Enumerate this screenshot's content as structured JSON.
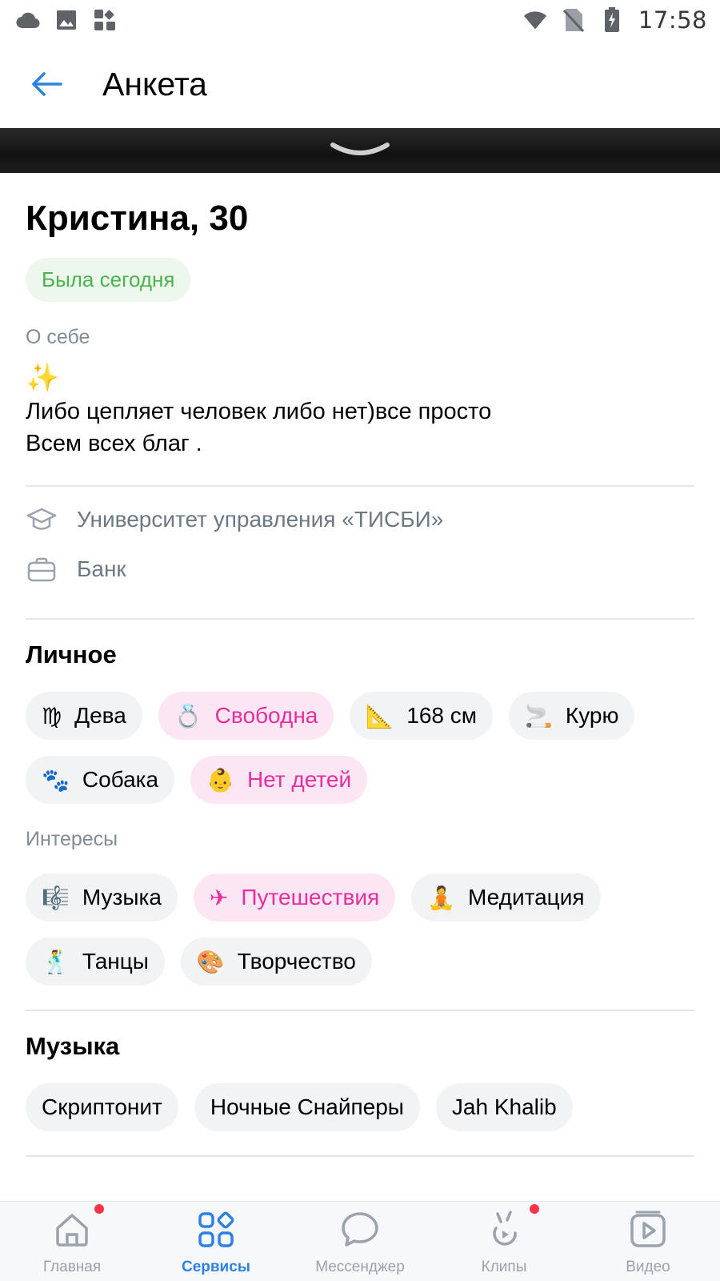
{
  "status_bar": {
    "time": "17:58",
    "left_icons": [
      "cloud-icon",
      "image-icon",
      "widgets-icon"
    ],
    "right_icons": [
      "wifi-icon",
      "no-sim-icon",
      "battery-charging-icon"
    ]
  },
  "header": {
    "title": "Анкета",
    "back_icon": "arrow-left-icon"
  },
  "profile": {
    "name": "Кристина, 30",
    "online_status": "Была сегодня",
    "about_label": "О себе",
    "about_emoji": "✨",
    "about_line1": "Либо цепляет человек либо нет)все просто",
    "about_line2": "Всем всех благ ."
  },
  "info": {
    "education": "Университет управления «ТИСБИ»",
    "work": "Банк"
  },
  "personal": {
    "title": "Личное",
    "chips": [
      {
        "emoji": "♍",
        "label": "Дева",
        "style": "gray"
      },
      {
        "emoji": "💍",
        "label": "Свободна",
        "style": "pink"
      },
      {
        "emoji": "📐",
        "label": "168 см",
        "style": "gray"
      },
      {
        "emoji": "🚬",
        "label": "Курю",
        "style": "gray"
      },
      {
        "emoji": "🐾",
        "label": "Собака",
        "style": "gray"
      },
      {
        "emoji": "👶",
        "label": "Нет детей",
        "style": "pink"
      }
    ]
  },
  "interests": {
    "label": "Интересы",
    "chips": [
      {
        "emoji": "🎼",
        "label": "Музыка",
        "style": "gray"
      },
      {
        "emoji": "✈",
        "label": "Путешествия",
        "style": "pink"
      },
      {
        "emoji": "🧘",
        "label": "Медитация",
        "style": "gray"
      },
      {
        "emoji": "🕺",
        "label": "Танцы",
        "style": "gray"
      },
      {
        "emoji": "🎨",
        "label": "Творчество",
        "style": "gray"
      }
    ]
  },
  "music": {
    "title": "Музыка",
    "chips": [
      "Скриптонит",
      "Ночные Снайперы",
      "Jah Khalib"
    ]
  },
  "tab_bar": {
    "tabs": [
      {
        "label": "Главная",
        "icon": "home-icon",
        "active": false,
        "dot": true
      },
      {
        "label": "Сервисы",
        "icon": "services-icon",
        "active": true,
        "dot": false
      },
      {
        "label": "Мессенджер",
        "icon": "messenger-icon",
        "active": false,
        "dot": false
      },
      {
        "label": "Клипы",
        "icon": "clips-icon",
        "active": false,
        "dot": true
      },
      {
        "label": "Видео",
        "icon": "video-icon",
        "active": false,
        "dot": false
      }
    ]
  },
  "colors": {
    "accent": "#2d81e0",
    "online_green": "#4bb34b",
    "pink": "#e62e9e",
    "notification": "#ff3347"
  }
}
